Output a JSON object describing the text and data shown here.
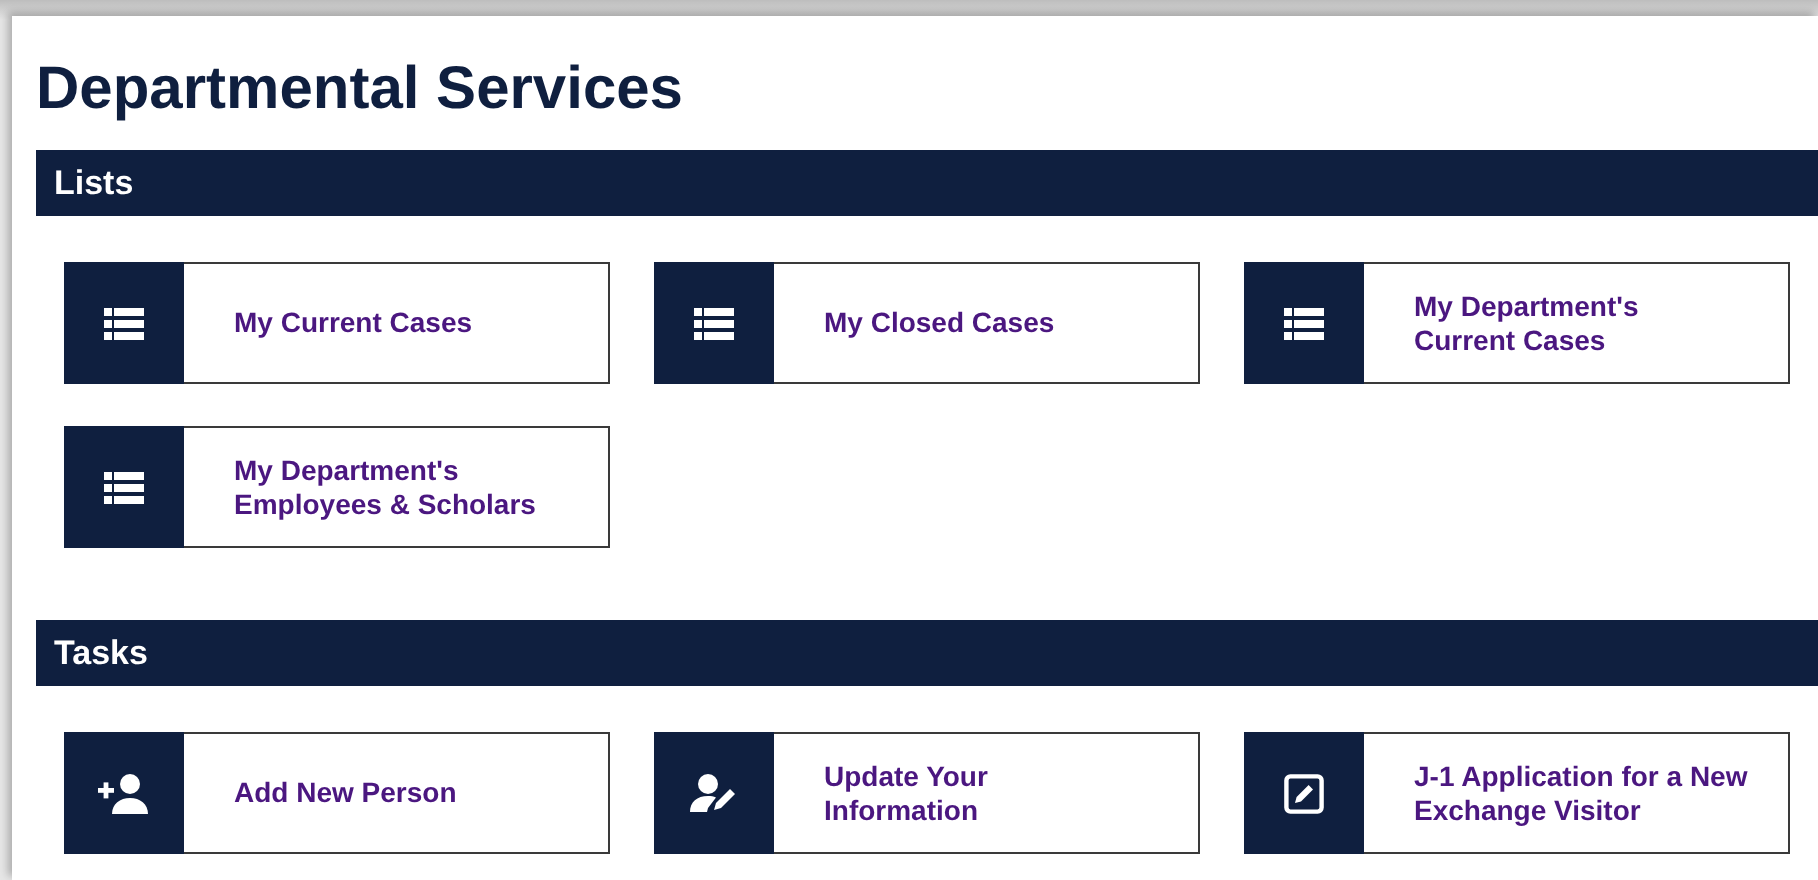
{
  "title": "Departmental Services",
  "sections": [
    {
      "heading": "Lists",
      "items": [
        {
          "kind": "list",
          "label": "My Current Cases"
        },
        {
          "kind": "list",
          "label": "My Closed Cases"
        },
        {
          "kind": "list",
          "label": "My Department's\nCurrent Cases"
        },
        {
          "kind": "list",
          "label": "My Department's\nEmployees & Scholars"
        }
      ]
    },
    {
      "heading": "Tasks",
      "items": [
        {
          "kind": "person-add",
          "label": "Add New Person"
        },
        {
          "kind": "person-edit",
          "label": "Update Your\nInformation"
        },
        {
          "kind": "edit",
          "label": "J-1 Application for a New\nExchange Visitor"
        }
      ]
    }
  ]
}
